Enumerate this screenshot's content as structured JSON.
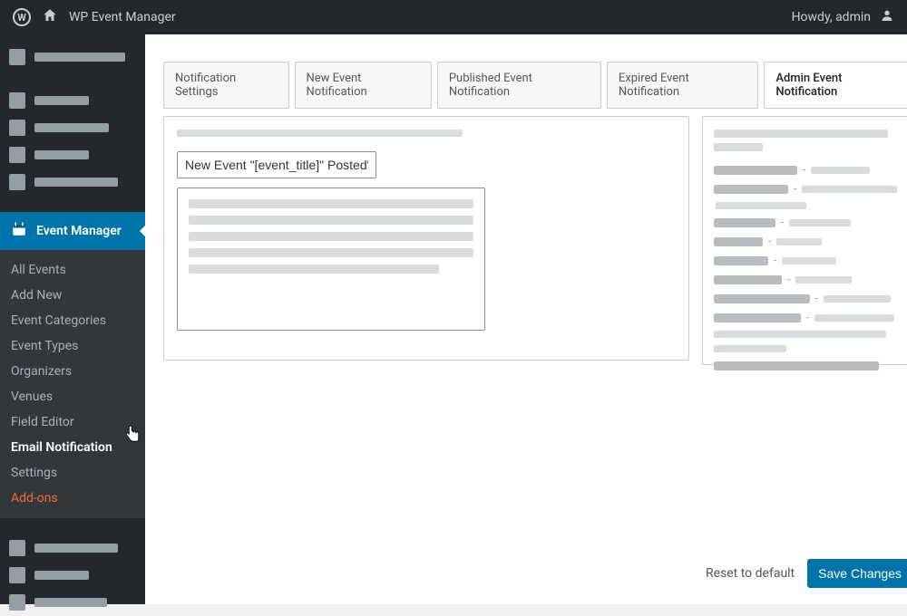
{
  "topbar": {
    "site_title": "WP Event Manager",
    "greeting": "Howdy, admin"
  },
  "sidebar": {
    "event_manager_label": "Event Manager",
    "submenu": [
      "All Events",
      "Add New",
      "Event Categories",
      "Event Types",
      "Organizers",
      "Venues",
      "Field Editor",
      "Email Notification",
      "Settings",
      "Add-ons"
    ]
  },
  "tabs": [
    "Notification Settings",
    "New Event Notification",
    "Published Event Notification",
    "Expired Event Notification",
    "Admin Event Notification"
  ],
  "form": {
    "subject_value": "New Event \"[event_title]\" Posted\""
  },
  "actions": {
    "reset_label": "Reset to default",
    "save_label": "Save Changes"
  }
}
